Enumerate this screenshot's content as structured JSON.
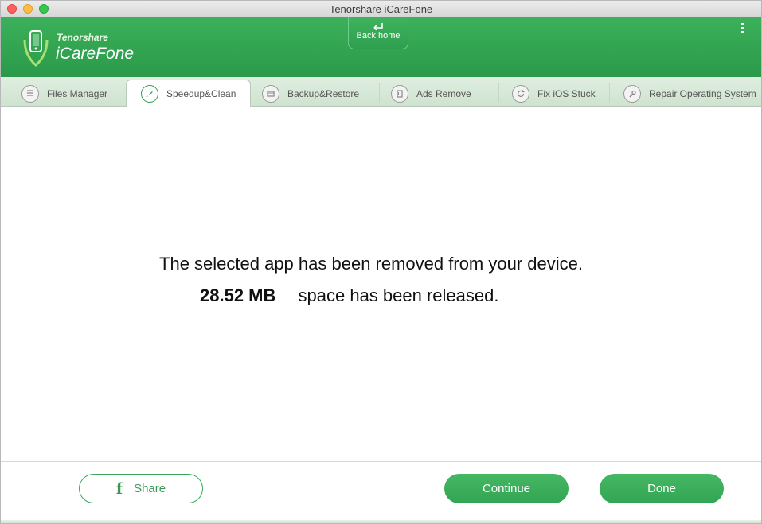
{
  "window": {
    "title": "Tenorshare iCareFone"
  },
  "header": {
    "brand_small": "Tenorshare",
    "brand_big": "iCareFone",
    "back_home_label": "Back home"
  },
  "tabs": [
    {
      "label": "Files Manager",
      "icon": "files-icon",
      "active": false
    },
    {
      "label": "Speedup&Clean",
      "icon": "rocket-icon",
      "active": true
    },
    {
      "label": "Backup&Restore",
      "icon": "backup-icon",
      "active": false
    },
    {
      "label": "Ads Remove",
      "icon": "ads-icon",
      "active": false
    },
    {
      "label": "Fix iOS Stuck",
      "icon": "refresh-icon",
      "active": false
    },
    {
      "label": "Repair Operating System",
      "icon": "wrench-icon",
      "active": false
    }
  ],
  "message": {
    "line1": "The selected app has been removed from your device.",
    "size": "28.52 MB",
    "line2_suffix": "space has been released."
  },
  "footer": {
    "share_label": "Share",
    "continue_label": "Continue",
    "done_label": "Done"
  },
  "colors": {
    "brand_green": "#2f9f4f",
    "tab_bg": "#d6e8d7"
  }
}
